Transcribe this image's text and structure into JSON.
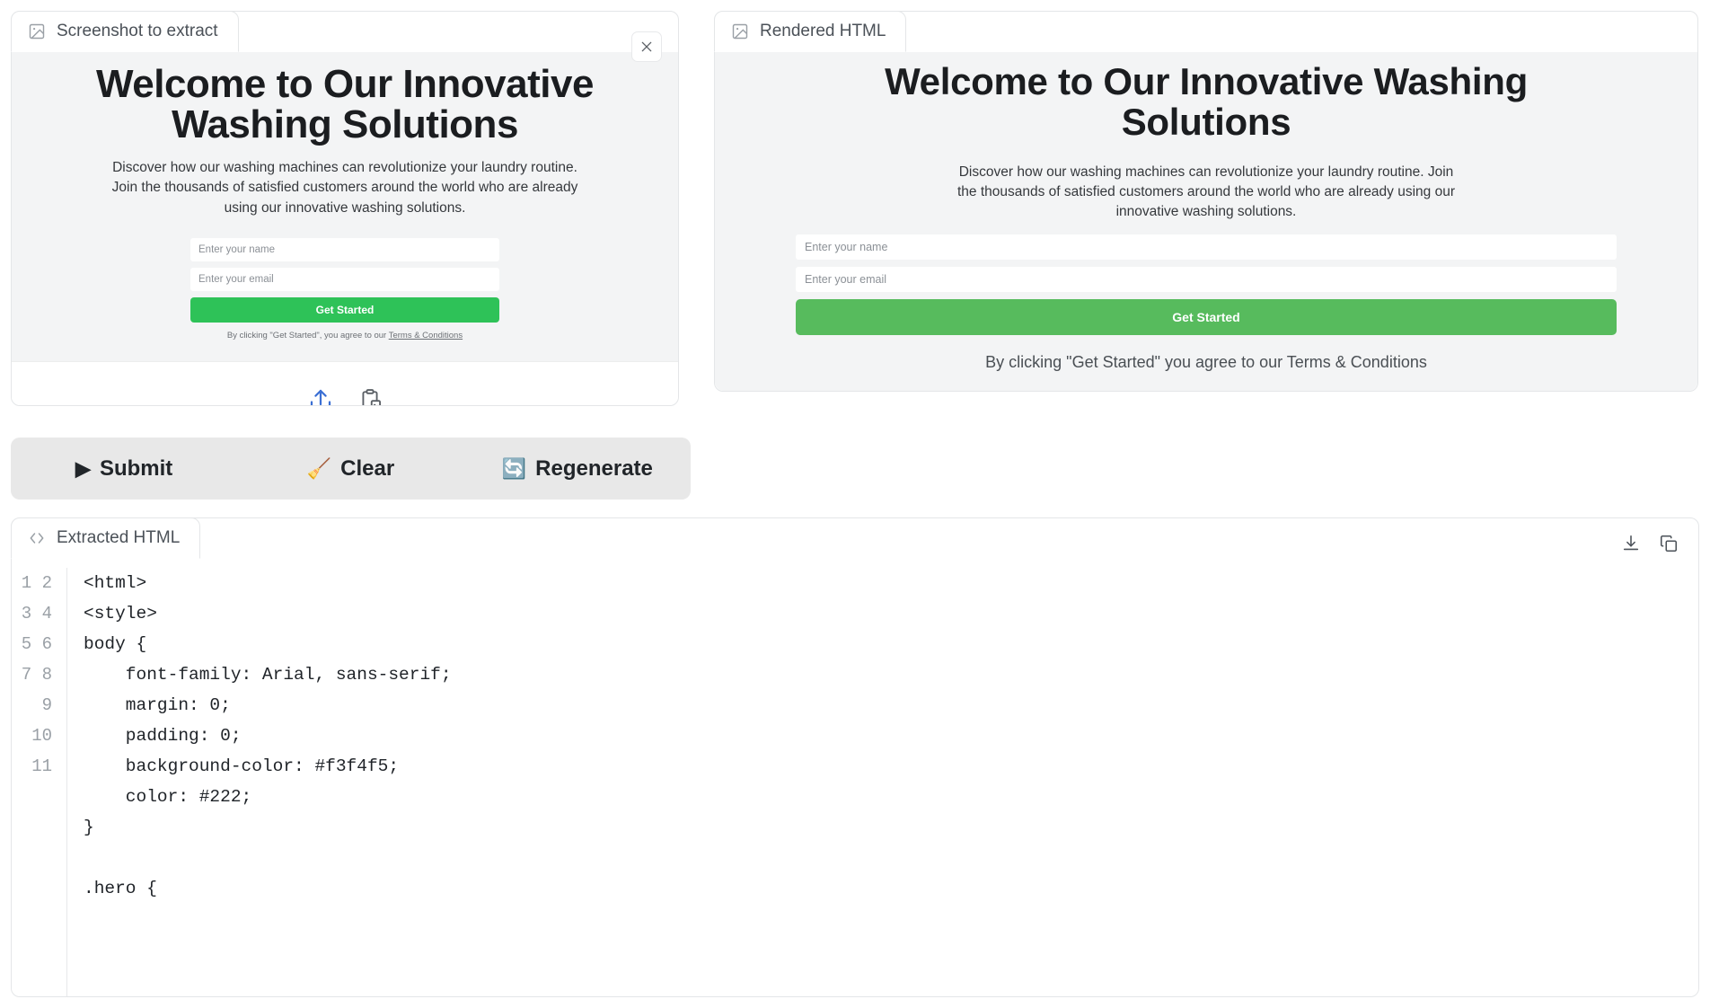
{
  "screenshot_panel": {
    "tab_label": "Screenshot to extract",
    "tab_icon": "image-icon",
    "close_icon": "close-icon",
    "hero": {
      "heading": "Welcome to Our Innovative Washing Solutions",
      "paragraph": "Discover how our washing machines can revolutionize your laundry routine. Join the thousands of satisfied customers around the world who are already using our innovative washing solutions.",
      "name_placeholder": "Enter your name",
      "email_placeholder": "Enter your email",
      "cta_label": "Get Started",
      "terms_prefix": "By clicking \"Get Started\", you agree to our ",
      "terms_link": "Terms & Conditions",
      "cta_color": "#2ec258",
      "background_color": "#f3f4f5"
    },
    "actions": {
      "upload_icon": "upload-icon",
      "paste_icon": "clipboard-image-icon"
    }
  },
  "render_panel": {
    "tab_label": "Rendered HTML",
    "tab_icon": "image-icon",
    "hero": {
      "heading": "Welcome to Our Innovative Washing Solutions",
      "paragraph": "Discover how our washing machines can revolutionize your laundry routine. Join the thousands of satisfied customers around the world who are already using our innovative washing solutions.",
      "name_placeholder": "Enter your name",
      "email_placeholder": "Enter your email",
      "cta_label": "Get Started",
      "terms_text": "By clicking \"Get Started\" you agree to our Terms & Conditions",
      "cta_color": "#57bb5d",
      "background_color": "#f3f4f5"
    }
  },
  "action_bar": {
    "background_color": "#e8e8e8",
    "buttons": [
      {
        "label": "Submit",
        "icon": "play-icon",
        "glyph": "▶"
      },
      {
        "label": "Clear",
        "icon": "broom-icon",
        "glyph": "🧹"
      },
      {
        "label": "Regenerate",
        "icon": "refresh-icon",
        "glyph": "🔄"
      }
    ]
  },
  "code_panel": {
    "tab_label": "Extracted HTML",
    "tab_icon": "code-icon",
    "tools": [
      {
        "name": "download-icon"
      },
      {
        "name": "copy-icon"
      }
    ],
    "line_numbers": "1\n2\n3\n4\n5\n6\n7\n8\n9\n10\n11",
    "code": "<html>\n<style>\nbody {\n    font-family: Arial, sans-serif;\n    margin: 0;\n    padding: 0;\n    background-color: #f3f4f5;\n    color: #222;\n}\n\n.hero {"
  }
}
